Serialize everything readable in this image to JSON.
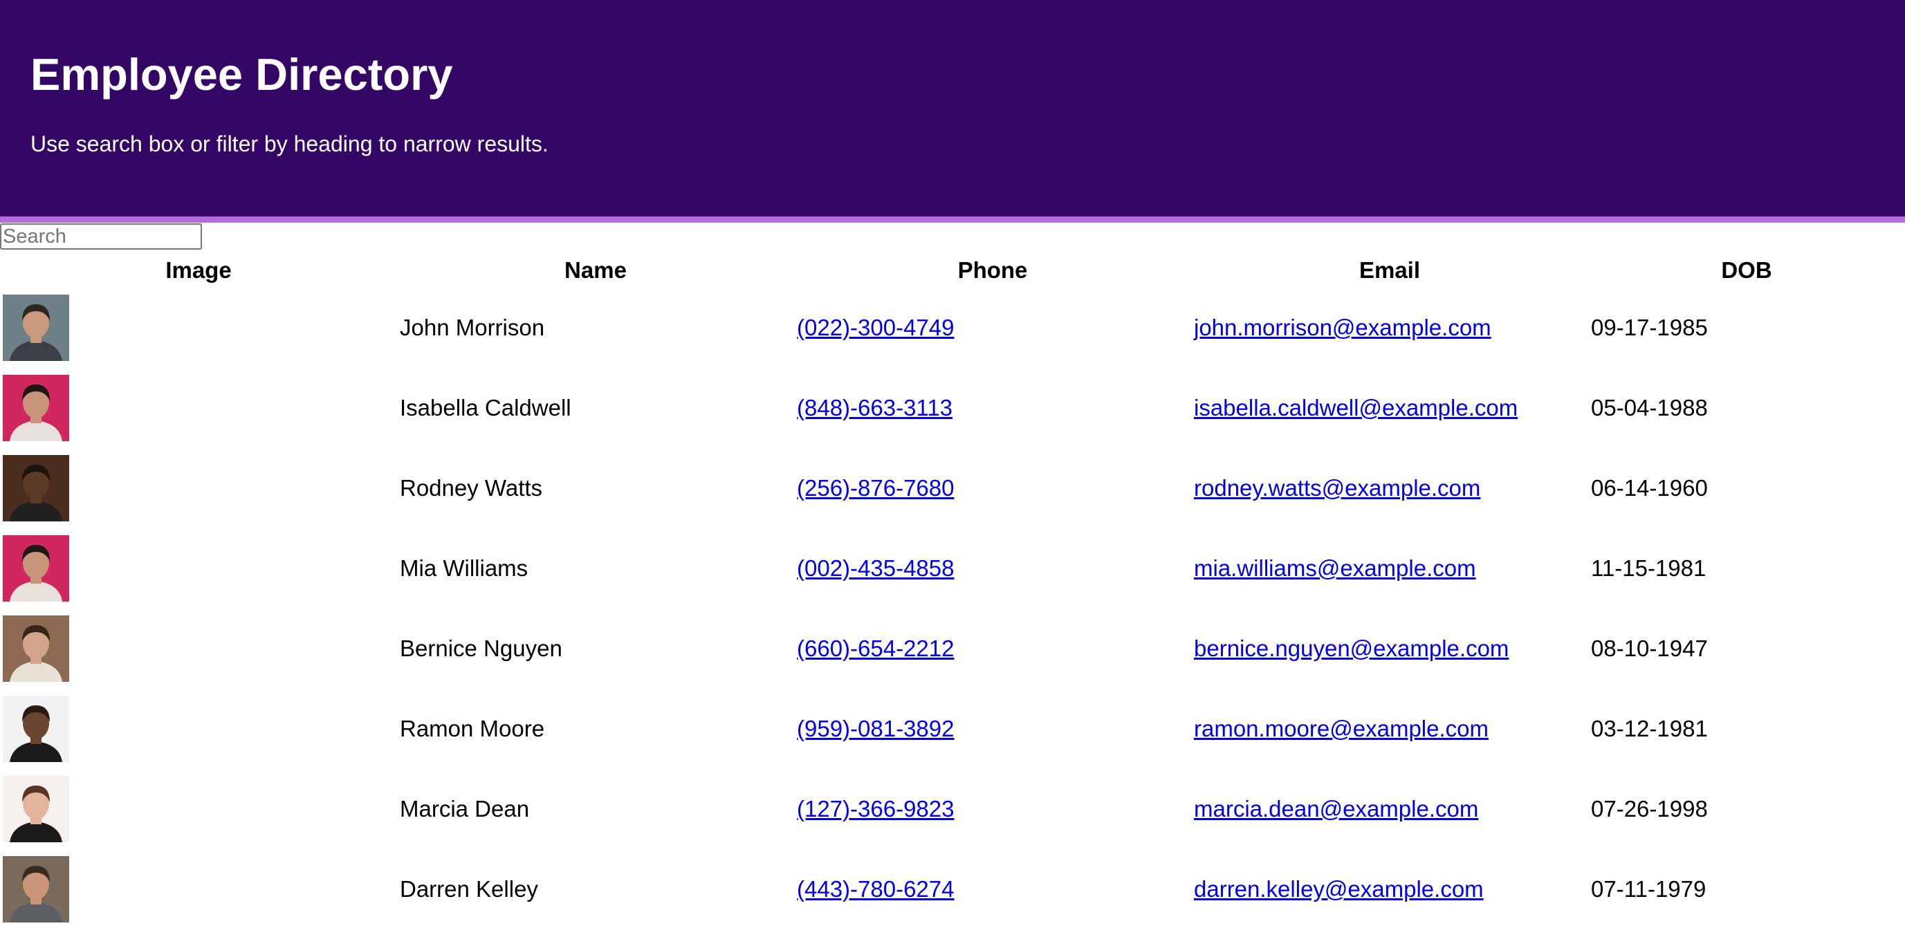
{
  "header": {
    "title": "Employee Directory",
    "subtitle": "Use search box or filter by heading to narrow results.",
    "background_color": "#340766",
    "accent_color": "#b56ddb"
  },
  "search": {
    "placeholder": "Search",
    "value": ""
  },
  "table": {
    "columns": [
      "Image",
      "Name",
      "Phone",
      "Email",
      "DOB"
    ],
    "rows": [
      {
        "name": "John Morrison",
        "phone": "(022)-300-4749",
        "email": "john.morrison@example.com",
        "dob": "09-17-1985",
        "photo": {
          "bg": "#6f7f88",
          "skin": "#c99a7e",
          "hair": "#2e2620",
          "shirt": "#3b4047"
        }
      },
      {
        "name": "Isabella Caldwell",
        "phone": "(848)-663-3113",
        "email": "isabella.caldwell@example.com",
        "dob": "05-04-1988",
        "photo": {
          "bg": "#d0285e",
          "skin": "#c8957a",
          "hair": "#1f1714",
          "shirt": "#e9e2dc"
        }
      },
      {
        "name": "Rodney Watts",
        "phone": "(256)-876-7680",
        "email": "rodney.watts@example.com",
        "dob": "06-14-1960",
        "photo": {
          "bg": "#4a2d1e",
          "skin": "#5b3a26",
          "hair": "#1d130d",
          "shirt": "#202020"
        }
      },
      {
        "name": "Mia Williams",
        "phone": "(002)-435-4858",
        "email": "mia.williams@example.com",
        "dob": "11-15-1981",
        "photo": {
          "bg": "#d0285e",
          "skin": "#c8957a",
          "hair": "#1f1714",
          "shirt": "#e9e2dc"
        }
      },
      {
        "name": "Bernice Nguyen",
        "phone": "(660)-654-2212",
        "email": "bernice.nguyen@example.com",
        "dob": "08-10-1947",
        "photo": {
          "bg": "#8c6b52",
          "skin": "#d2a58a",
          "hair": "#3a2418",
          "shirt": "#e8e1d8"
        }
      },
      {
        "name": "Ramon Moore",
        "phone": "(959)-081-3892",
        "email": "ramon.moore@example.com",
        "dob": "03-12-1981",
        "photo": {
          "bg": "#f2f2f2",
          "skin": "#6a4632",
          "hair": "#2a1b12",
          "shirt": "#1a1a1a"
        }
      },
      {
        "name": "Marcia Dean",
        "phone": "(127)-366-9823",
        "email": "marcia.dean@example.com",
        "dob": "07-26-1998",
        "photo": {
          "bg": "#f4f1ee",
          "skin": "#e3b59a",
          "hair": "#5a3525",
          "shirt": "#1b1b1b"
        }
      },
      {
        "name": "Darren Kelley",
        "phone": "(443)-780-6274",
        "email": "darren.kelley@example.com",
        "dob": "07-11-1979",
        "photo": {
          "bg": "#7a6a5c",
          "skin": "#c99478",
          "hair": "#3a2a20",
          "shirt": "#5b5e63"
        }
      }
    ]
  },
  "link_color": "#0000ee"
}
